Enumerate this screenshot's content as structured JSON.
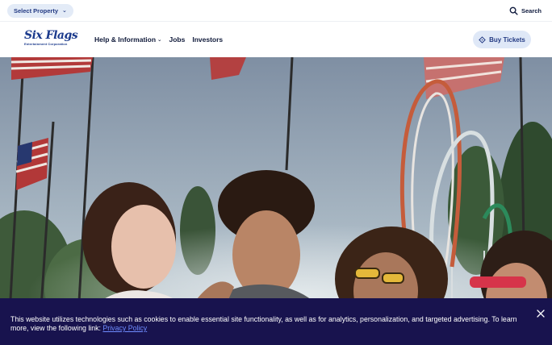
{
  "topbar": {
    "select_property_label": "Select Property",
    "select_property_icon": "chevron-down-icon",
    "search_label": "Search",
    "search_icon": "search-icon"
  },
  "nav": {
    "logo": {
      "wordmark": "Six Flags",
      "subtitle": "Entertainment Corporation"
    },
    "links": [
      {
        "label": "Help & Information",
        "has_dropdown": true
      },
      {
        "label": "Jobs",
        "has_dropdown": false
      },
      {
        "label": "Investors",
        "has_dropdown": false
      }
    ],
    "buy_button": {
      "label": "Buy Tickets",
      "icon": "ticket-icon"
    }
  },
  "hero": {
    "image": "photo of teens at amusement park with flags and roller coaster"
  },
  "cookie_banner": {
    "message": "This website utilizes technologies such as cookies to enable essential site functionality, as well as for analytics, personalization, and targeted advertising. To learn more, view the following link: ",
    "link_label": "Privacy Policy",
    "close_icon": "close-icon"
  },
  "colors": {
    "brand_blue": "#1b3a8c",
    "pill_bg": "#e3ebf7",
    "banner_bg": "#18134e",
    "link_color": "#6f8cff"
  }
}
